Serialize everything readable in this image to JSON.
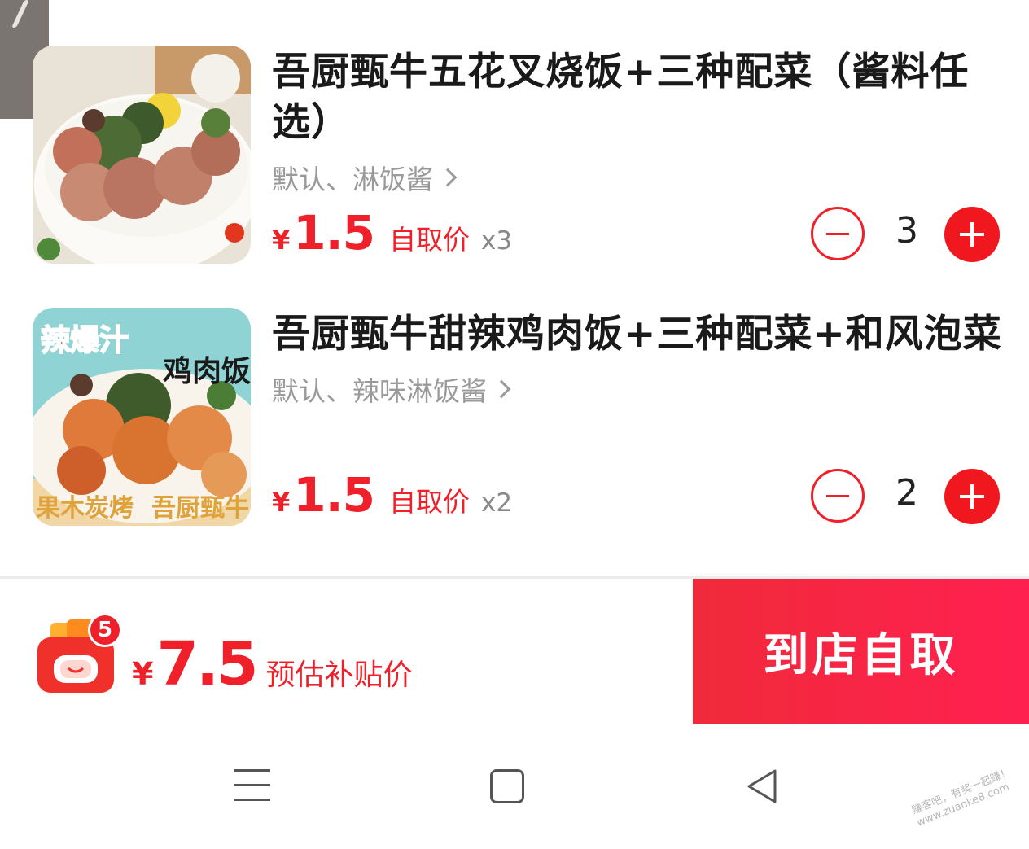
{
  "cart_items": [
    {
      "title": "吾厨甄牛五花叉烧饭+三种配菜（酱料任选）",
      "spec": "默认、淋饭酱",
      "currency": "¥",
      "price": "1.5",
      "price_label": "自取价",
      "multiplier": "x3",
      "quantity": "3",
      "thumb_icon": "bowl-pork-rice-image"
    },
    {
      "title": "吾厨甄牛甜辣鸡肉饭+三种配菜+和风泡菜",
      "spec": "默认、辣味淋饭酱",
      "currency": "¥",
      "price": "1.5",
      "price_label": "自取价",
      "multiplier": "x2",
      "quantity": "2",
      "thumb_icon": "bowl-chicken-rice-image",
      "thumb_texts": [
        "辣爆汁",
        "鸡肉饭",
        "果木炭烤",
        "吾厨甄牛"
      ]
    }
  ],
  "cart_bar": {
    "badge_count": "5",
    "currency": "¥",
    "total": "7.5",
    "total_label": "预估补贴价",
    "checkout_label": "到店自取"
  },
  "watermark": {
    "line1": "赚客吧，有奖一起赚！",
    "line2": "www.zuanke8.com"
  },
  "colors": {
    "accent": "#f0202a",
    "spec_gray": "#9a9a9a"
  }
}
